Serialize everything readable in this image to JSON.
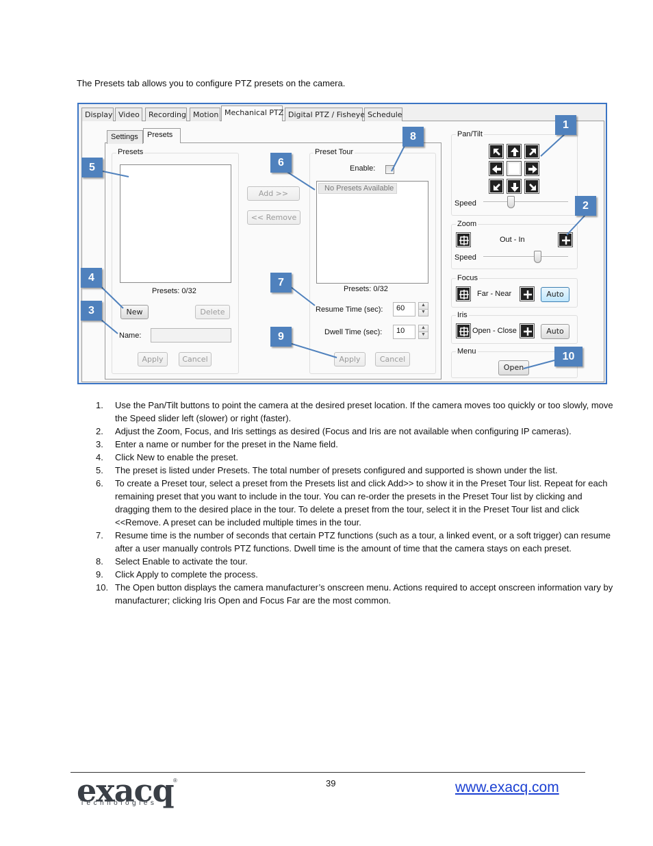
{
  "intro": "The Presets tab allows you to configure PTZ presets on the camera.",
  "tabs": [
    "Display",
    "Video",
    "Recording",
    "Motion",
    "Mechanical PTZ",
    "Digital PTZ / Fisheye",
    "Schedule"
  ],
  "subtabs": [
    "Settings",
    "Presets"
  ],
  "presets": {
    "group": "Presets",
    "count": "Presets:  0/32",
    "new_label": "New",
    "delete_label": "Delete",
    "name_label": "Name:",
    "apply_label": "Apply",
    "cancel_label": "Cancel"
  },
  "middle": {
    "add_label": "Add >>",
    "remove_label": "<< Remove"
  },
  "tour": {
    "group": "Preset Tour",
    "enable_label": "Enable:",
    "empty_item": "No Presets Available",
    "count": "Presets:  0/32",
    "resume_label": "Resume Time (sec):",
    "resume_value": "60",
    "dwell_label": "Dwell Time (sec):",
    "dwell_value": "10",
    "apply_label": "Apply",
    "cancel_label": "Cancel"
  },
  "ptz": {
    "pantilt_label": "Pan/Tilt",
    "speed_label": "Speed",
    "zoom_label": "Zoom",
    "zoom_text": "Out - In",
    "zoom_speed_label": "Speed",
    "focus_label": "Focus",
    "focus_text": "Far - Near",
    "focus_auto": "Auto",
    "iris_label": "Iris",
    "iris_text": "Open - Close",
    "iris_auto": "Auto",
    "menu_label": "Menu",
    "menu_open": "Open"
  },
  "callouts": [
    "1",
    "2",
    "3",
    "4",
    "5",
    "6",
    "7",
    "8",
    "9",
    "10"
  ],
  "steps": [
    {
      "num": "1.",
      "text": "Use the Pan/Tilt buttons to point the camera at the desired preset location. If the camera moves too quickly or too slowly, move the Speed slider left (slower) or right (faster)."
    },
    {
      "num": "2.",
      "text": "Adjust the Zoom, Focus, and Iris settings as desired (Focus and Iris are not available when configuring IP cameras)."
    },
    {
      "num": "3.",
      "text": "Enter a name or number for the preset in the Name field."
    },
    {
      "num": "4.",
      "text": "Click New to enable the preset."
    },
    {
      "num": "5.",
      "text": "The preset is listed under Presets. The total number of presets configured and supported is shown under the list."
    },
    {
      "num": "6.",
      "text": "To create a Preset tour, select a preset from the Presets list and click Add>> to show it in the Preset Tour list. Repeat for each remaining preset that you want to include in the tour. You can re-order the presets in the Preset Tour list by clicking and dragging them to the desired place in the tour. To delete a preset from the tour, select it in the Preset Tour list and click <<Remove. A preset can be included multiple times in the tour."
    },
    {
      "num": "7.",
      "text": "Resume time is the number of seconds that certain PTZ functions (such as a tour, a linked event, or a soft trigger) can resume after a user manually controls PTZ functions. Dwell time is the amount of time that the camera stays on each preset."
    },
    {
      "num": "8.",
      "text": "Select Enable to activate the tour."
    },
    {
      "num": "9.",
      "text": "Click Apply to complete the process."
    },
    {
      "num": "10.",
      "text": "The Open button displays the camera manufacturer’s onscreen menu. Actions required to accept onscreen information vary by manufacturer; clicking Iris Open and Focus Far are the most common."
    }
  ],
  "footer": {
    "page_number": "39",
    "url": "www.exacq.com",
    "logo_word": "exacq",
    "logo_sub": "Technologies",
    "logo_reg": "®"
  },
  "colors": {
    "callout": "#4f81bd",
    "frame": "#3a74c4",
    "link": "#1a3fd2"
  }
}
